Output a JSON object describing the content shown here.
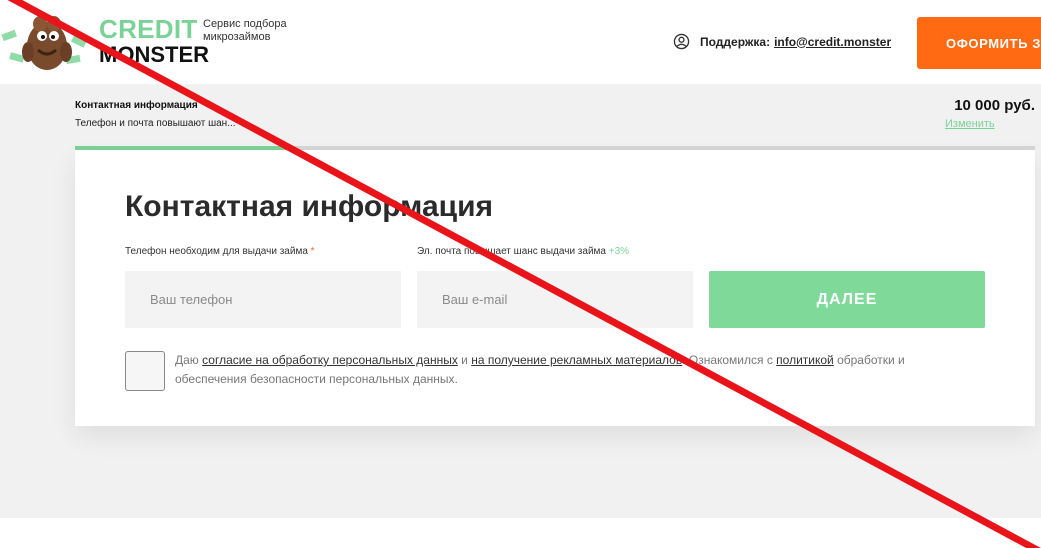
{
  "header": {
    "logo_top": "CREDIT",
    "logo_bottom": "MONSTER",
    "tagline": "Сервис подбора микрозаймов",
    "support_label": "Поддержка:",
    "support_email": "info@credit.monster",
    "apply_button": "ОФОРМИТЬ З"
  },
  "step": {
    "title": "Контактная информация",
    "subtitle": "Телефон и почта повышают шан...",
    "amount": "10 000 руб.",
    "change_link": "Изменить",
    "progress_fraction": 0.22
  },
  "form": {
    "title": "Контактная информация",
    "phone_label": "Телефон необходим для выдачи займа",
    "phone_required": "*",
    "phone_placeholder": "Ваш телефон",
    "email_label": "Эл. почта повышает шанс выдачи займа",
    "email_bonus": "+3%",
    "email_placeholder": "Ваш e-mail",
    "next_button": "ДАЛЕЕ"
  },
  "consent": {
    "text_1": "Даю ",
    "link_1": "согласие на обработку персональных данных",
    "text_2": " и ",
    "link_2": "на получение рекламных материалов",
    "text_3": ". Ознакомился с ",
    "link_3": "политикой",
    "text_4": " обработки и обеспечения безопасности персональных данных."
  },
  "colors": {
    "brand_green": "#7bd297",
    "brand_orange": "#ff6a13",
    "overlay_red": "#e8141a"
  }
}
